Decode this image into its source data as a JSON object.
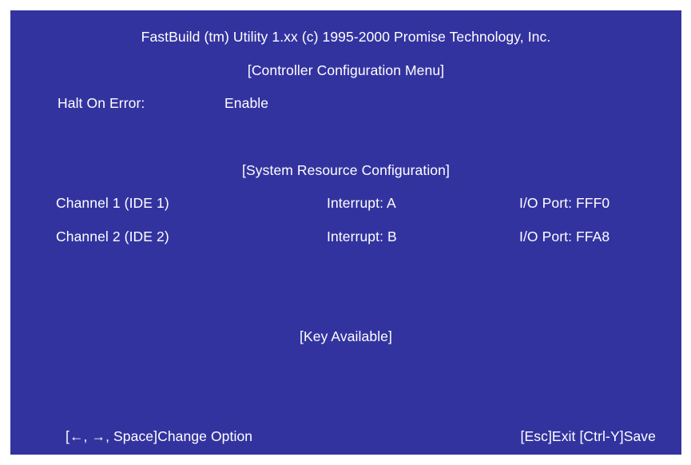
{
  "header": {
    "title": "FastBuild (tm) Utility 1.xx (c) 1995-2000 Promise Technology, Inc.",
    "menu_title": "[Controller Configuration Menu]"
  },
  "controller": {
    "halt_on_error": {
      "label": "Halt On Error:",
      "value": "Enable"
    }
  },
  "resources": {
    "section_title": "[System Resource Configuration]",
    "channels": [
      {
        "name": "Channel 1 (IDE 1)",
        "interrupt": "Interrupt: A",
        "io_port": "I/O Port: FFF0"
      },
      {
        "name": "Channel 2 (IDE 2)",
        "interrupt": "Interrupt: B",
        "io_port": "I/O Port: FFA8"
      }
    ]
  },
  "keys": {
    "section_title": "[Key Available]",
    "left_hint": "[←, →, Space]Change Option",
    "right_hint": "[Esc]Exit [Ctrl-Y]Save"
  },
  "colors": {
    "background": "#3333a0",
    "text": "#ffffff"
  }
}
